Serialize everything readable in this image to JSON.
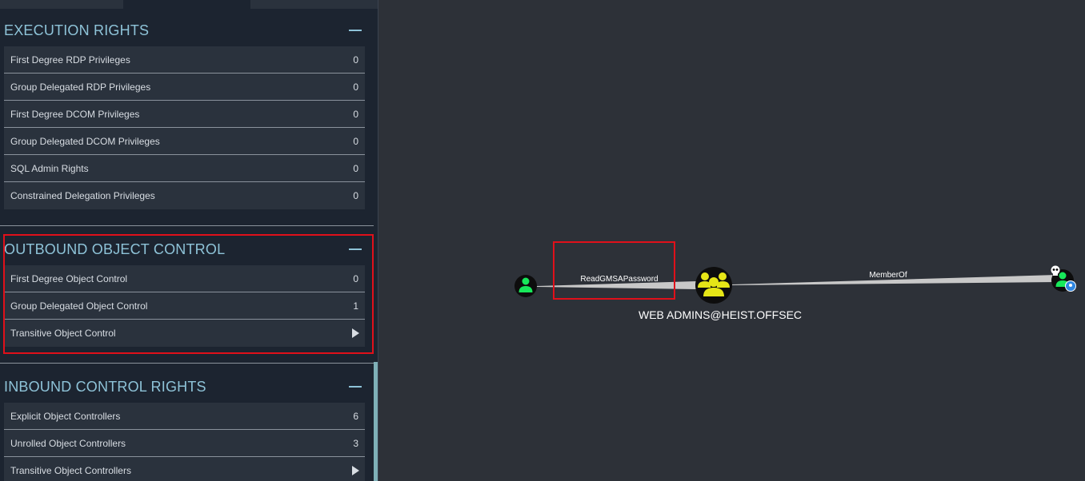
{
  "sidebar": {
    "execution_rights": {
      "title": "EXECUTION RIGHTS",
      "rows": [
        {
          "label": "First Degree RDP Privileges",
          "value": "0"
        },
        {
          "label": "Group Delegated RDP Privileges",
          "value": "0"
        },
        {
          "label": "First Degree DCOM Privileges",
          "value": "0"
        },
        {
          "label": "Group Delegated DCOM Privileges",
          "value": "0"
        },
        {
          "label": "SQL Admin Rights",
          "value": "0"
        },
        {
          "label": "Constrained Delegation Privileges",
          "value": "0"
        }
      ]
    },
    "outbound_object_control": {
      "title": "OUTBOUND OBJECT CONTROL",
      "rows": [
        {
          "label": "First Degree Object Control",
          "value": "0"
        },
        {
          "label": "Group Delegated Object Control",
          "value": "1"
        },
        {
          "label": "Transitive Object Control",
          "value": ""
        }
      ]
    },
    "inbound_control_rights": {
      "title": "INBOUND CONTROL RIGHTS",
      "rows": [
        {
          "label": "Explicit Object Controllers",
          "value": "6"
        },
        {
          "label": "Unrolled Object Controllers",
          "value": "3"
        },
        {
          "label": "Transitive Object Controllers",
          "value": ""
        }
      ]
    }
  },
  "graph": {
    "edges": [
      {
        "label": "ReadGMSAPassword"
      },
      {
        "label": "MemberOf"
      }
    ],
    "nodes": {
      "user_source": {
        "icon": "user-icon"
      },
      "group": {
        "label": "WEB ADMINS@HEIST.OFFSEC",
        "icon": "group-icon"
      },
      "target": {
        "icon": "user-icon",
        "badges": [
          "skull-icon",
          "location-pin-icon"
        ]
      }
    }
  },
  "colors": {
    "sidebar_bg": "#1c2430",
    "row_bg": "#2a323d",
    "section_title": "#8ec3d8",
    "graph_bg": "#2d3138",
    "highlight": "#e0101a",
    "user_node": "#17e85a",
    "group_node": "#e6e617"
  }
}
